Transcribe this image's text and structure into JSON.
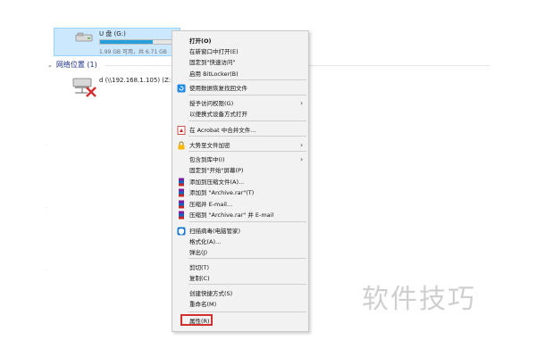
{
  "drive": {
    "name": "U 盘 (G:)",
    "free_text": "1.99 GB 可用，共 6.71 GB",
    "used_fraction": 0.72
  },
  "network_group": {
    "title": "网络位置 (1)"
  },
  "network_drive": {
    "name": "d (\\\\192.168.1.105) (Z:)"
  },
  "context_menu": {
    "items": [
      {
        "label": "打开(O)",
        "bold": true
      },
      {
        "label": "在新窗口中打开(E)"
      },
      {
        "label": "固定到\"快速访问\""
      },
      {
        "label": "启用 BitLocker(B)"
      },
      {
        "label": "使用数据恢复找回文件",
        "icon": "recovery-icon"
      },
      {
        "label": "授予访问权限(G)",
        "submenu": true
      },
      {
        "label": "以便携式设备方式打开"
      },
      {
        "label": "在 Acrobat 中合并文件...",
        "icon": "acrobat-icon"
      },
      {
        "label": "大势至文件加密",
        "icon": "lock-icon",
        "submenu": true
      },
      {
        "label": "包含到库中(I)",
        "submenu": true
      },
      {
        "label": "固定到\"开始\"屏幕(P)"
      },
      {
        "label": "添加到压缩文件(A)...",
        "icon": "winrar-icon"
      },
      {
        "label": "添加到 \"Archive.rar\"(T)",
        "icon": "winrar-icon"
      },
      {
        "label": "压缩并 E-mail...",
        "icon": "winrar-icon"
      },
      {
        "label": "压缩到 \"Archive.rar\" 并 E-mail",
        "icon": "winrar-icon"
      },
      {
        "label": "扫描病毒(电脑管家)",
        "icon": "shield-icon"
      },
      {
        "label": "格式化(A)..."
      },
      {
        "label": "弹出(J)"
      },
      {
        "label": "剪切(T)"
      },
      {
        "label": "复制(C)"
      },
      {
        "label": "创建快捷方式(S)"
      },
      {
        "label": "重命名(M)"
      },
      {
        "label": "属性(R)"
      }
    ]
  },
  "highlight_color": "#d32f2f",
  "watermark": "软件技巧"
}
